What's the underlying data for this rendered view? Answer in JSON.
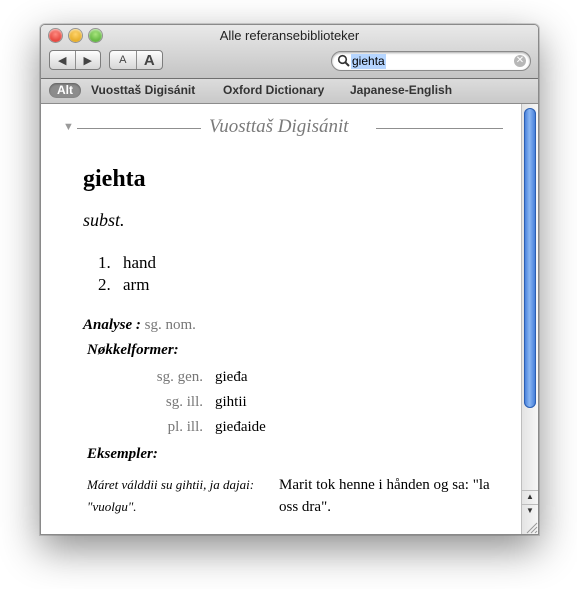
{
  "window": {
    "title": "Alle referansebiblioteker"
  },
  "toolbar": {
    "back_label": "◀",
    "forward_label": "▶",
    "font_small_label": "A",
    "font_large_label": "A"
  },
  "search": {
    "value": "giehta",
    "icon": "search-icon",
    "clear_icon": "clear-icon"
  },
  "scopes": [
    "Alt",
    "Vuosttaš Digisánit",
    "Oxford Dictionary",
    "Japanese-English"
  ],
  "entry": {
    "section_title": "Vuosttaš Digisánit",
    "headword": "giehta",
    "pos": "subst.",
    "senses": [
      {
        "num": "1.",
        "text": "hand"
      },
      {
        "num": "2.",
        "text": "arm"
      }
    ],
    "analyse_label": "Analyse :",
    "analyse_value": "sg. nom.",
    "keyforms_label": "Nøkkelformer:",
    "keyforms": [
      {
        "tag": "sg. gen.",
        "form": "gieđa"
      },
      {
        "tag": "sg. ill.",
        "form": "gihtii"
      },
      {
        "tag": "pl. ill.",
        "form": "gieđaide"
      }
    ],
    "examples_label": "Eksempler:",
    "example_source": "Máret válddii su gihtii, ja dajai: \"vuolgu\".",
    "example_translation": "Marit tok henne i hånden og sa: \"la oss dra\"."
  }
}
